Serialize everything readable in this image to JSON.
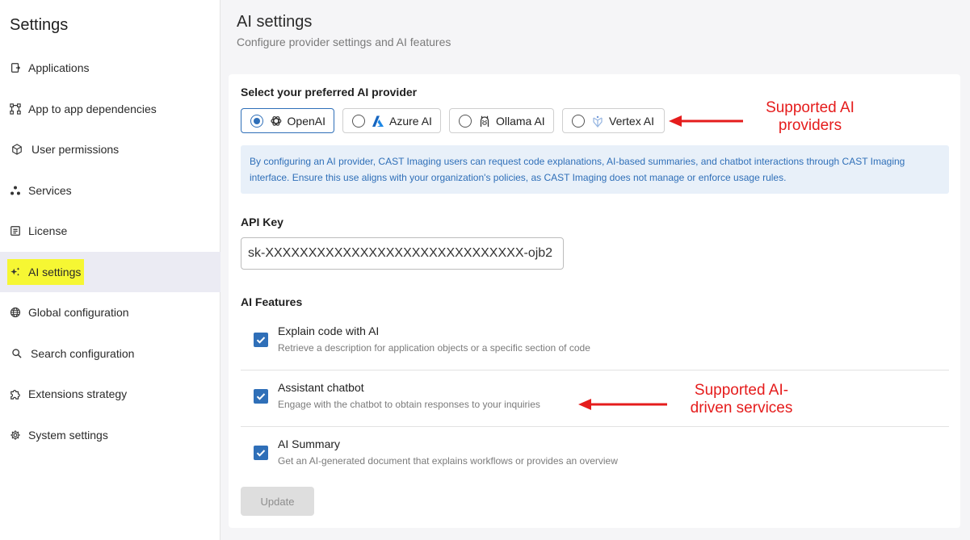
{
  "sidebar": {
    "title": "Settings",
    "items": [
      {
        "label": "Applications",
        "icon": "application-icon"
      },
      {
        "label": "App to app dependencies",
        "icon": "dependencies-icon"
      },
      {
        "label": "User permissions",
        "icon": "cube-icon"
      },
      {
        "label": "Services",
        "icon": "services-icon"
      },
      {
        "label": "License",
        "icon": "license-icon"
      },
      {
        "label": "AI settings",
        "icon": "sparkle-icon",
        "active": true
      },
      {
        "label": "Global configuration",
        "icon": "globe-icon"
      },
      {
        "label": "Search configuration",
        "icon": "search-icon"
      },
      {
        "label": "Extensions strategy",
        "icon": "puzzle-icon"
      },
      {
        "label": "System settings",
        "icon": "gear-icon"
      }
    ]
  },
  "header": {
    "title": "AI settings",
    "subtitle": "Configure provider settings and AI features"
  },
  "provider_section": {
    "label": "Select your preferred AI provider",
    "selected": "OpenAI",
    "providers": [
      {
        "label": "OpenAI",
        "icon": "openai-icon"
      },
      {
        "label": "Azure AI",
        "icon": "azure-icon"
      },
      {
        "label": "Ollama AI",
        "icon": "ollama-icon"
      },
      {
        "label": "Vertex AI",
        "icon": "vertex-icon"
      }
    ],
    "info": "By configuring an AI provider, CAST Imaging users can request code explanations, AI-based summaries, and chatbot interactions through CAST Imaging interface. Ensure this use aligns with your organization's policies, as CAST Imaging does not manage or enforce usage rules."
  },
  "api_key": {
    "label": "API Key",
    "value": "sk-XXXXXXXXXXXXXXXXXXXXXXXXXXXXXX-ojb2"
  },
  "features": {
    "label": "AI Features",
    "items": [
      {
        "title": "Explain code with AI",
        "description": "Retrieve a description for application objects or a specific section of code",
        "checked": true
      },
      {
        "title": "Assistant chatbot",
        "description": "Engage with the chatbot to obtain responses to your inquiries",
        "checked": true
      },
      {
        "title": "AI Summary",
        "description": "Get an AI-generated document that explains workflows or provides an overview",
        "checked": true
      }
    ]
  },
  "update_button": "Update",
  "annotations": {
    "providers_line1": "Supported AI",
    "providers_line2": "providers",
    "services_line1": "Supported AI-",
    "services_line2": "driven services",
    "color": "#e51c1c"
  },
  "colors": {
    "accent": "#2f6fb8",
    "highlight": "#f6f733"
  }
}
